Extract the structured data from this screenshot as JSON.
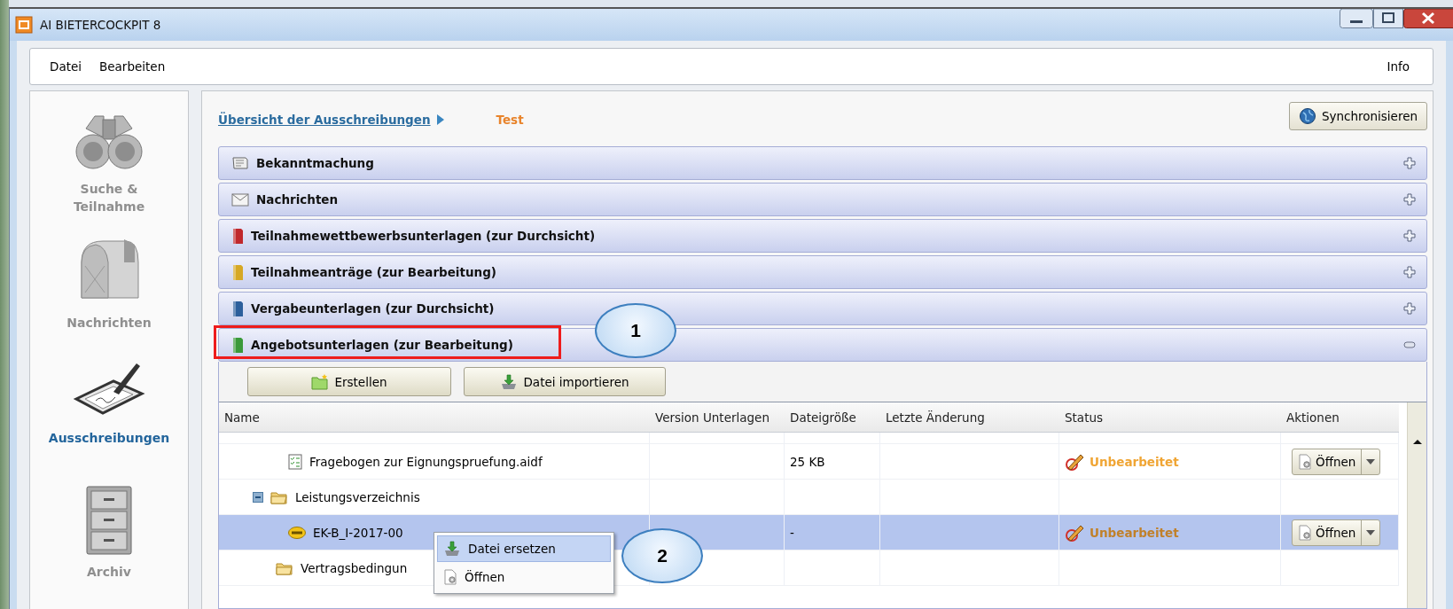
{
  "window": {
    "title": "AI BIETERCOCKPIT 8"
  },
  "menu": {
    "items": [
      {
        "label": "Datei"
      },
      {
        "label": "Bearbeiten"
      }
    ],
    "right_item": "Info"
  },
  "sidebar": {
    "items": [
      {
        "label": "Suche & Teilnahme",
        "kind": "binoculars",
        "selected": false
      },
      {
        "label": "Nachrichten",
        "kind": "mailbox",
        "selected": false
      },
      {
        "label": "Ausschreibungen",
        "kind": "tablet",
        "selected": true
      },
      {
        "label": "Archiv",
        "kind": "cabinet",
        "selected": false
      }
    ]
  },
  "breadcrumb": {
    "link": "Übersicht der Ausschreibungen",
    "current": "Test"
  },
  "sync_button": "Synchronisieren",
  "sections": [
    {
      "title": "Bekanntmachung",
      "kind": "notice",
      "expanded": false,
      "highlighted": false
    },
    {
      "title": "Nachrichten",
      "kind": "mail",
      "expanded": false,
      "highlighted": false
    },
    {
      "title": "Teilnahmewettbewerbsunterlagen (zur Durchsicht)",
      "kind": "binder",
      "color": "#c0282c",
      "expanded": false,
      "highlighted": false
    },
    {
      "title": "Teilnahmeanträge (zur Bearbeitung)",
      "kind": "binder",
      "color": "#d6a824",
      "expanded": false,
      "highlighted": false
    },
    {
      "title": "Vergabeunterlagen (zur Durchsicht)",
      "kind": "binder",
      "color": "#2c5f9c",
      "expanded": false,
      "highlighted": false
    },
    {
      "title": "Angebotsunterlagen (zur Bearbeitung)",
      "kind": "binder",
      "color": "#3a9a3a",
      "expanded": true,
      "highlighted": true
    }
  ],
  "toolbar": [
    {
      "label": "Erstellen",
      "kind": "create"
    },
    {
      "label": "Datei importieren",
      "kind": "import"
    }
  ],
  "table": {
    "columns": [
      "Name",
      "Version Unterlagen",
      "Dateigröße",
      "Letzte Änderung",
      "Status",
      "Aktionen"
    ],
    "rows": [
      {
        "name": "Fragebogen zur Eignungspruefung.aidf",
        "kind": "checklist",
        "size": "25 KB",
        "status": "Unbearbeitet",
        "action": "Öffnen",
        "selected": false
      },
      {
        "name": "Leistungsverzeichnis",
        "kind": "folder",
        "expanded": true,
        "selected": false
      },
      {
        "name": "EK-B_I-2017-00",
        "kind": "gaeb",
        "size": "-",
        "status": "Unbearbeitet",
        "action": "Öffnen",
        "selected": true
      },
      {
        "name": "Vertragsbedingun",
        "kind": "folder",
        "selected": false
      }
    ]
  },
  "context_menu": {
    "items": [
      {
        "label": "Datei ersetzen",
        "kind": "import",
        "selected": true
      },
      {
        "label": "Öffnen",
        "kind": "open",
        "selected": false
      }
    ]
  },
  "callouts": [
    {
      "label": "1"
    },
    {
      "label": "2"
    }
  ]
}
